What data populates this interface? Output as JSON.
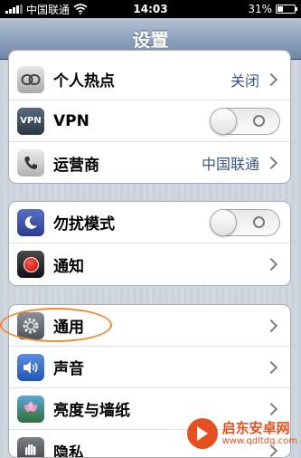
{
  "status_bar": {
    "carrier": "中国联通",
    "time": "14:03",
    "battery_text": "31%",
    "battery_level": 0.31
  },
  "nav": {
    "title": "设置"
  },
  "groups": [
    {
      "rows": [
        {
          "label": "个人热点",
          "value": "关闭",
          "icon": "hotspot-link-icon",
          "accessory": "chevron"
        },
        {
          "label": "VPN",
          "icon_text": "VPN",
          "icon": "vpn-icon",
          "accessory": "toggle",
          "toggle_on": false
        },
        {
          "label": "运营商",
          "value": "中国联通",
          "icon": "phone-icon",
          "accessory": "chevron"
        }
      ]
    },
    {
      "rows": [
        {
          "label": "勿扰模式",
          "icon": "moon-icon",
          "accessory": "toggle",
          "toggle_on": false
        },
        {
          "label": "通知",
          "icon": "notification-icon",
          "accessory": "chevron"
        }
      ]
    },
    {
      "rows": [
        {
          "label": "通用",
          "icon": "gear-icon",
          "accessory": "chevron",
          "highlighted": true
        },
        {
          "label": "声音",
          "icon": "speaker-icon",
          "accessory": "chevron"
        },
        {
          "label": "亮度与墙纸",
          "icon": "flower-icon",
          "accessory": "chevron"
        },
        {
          "label": "隐私",
          "icon": "hand-icon",
          "accessory": "chevron"
        }
      ]
    }
  ],
  "watermark": {
    "name": "启东安卓网",
    "url": "www.qdltdq.com"
  },
  "colors": {
    "annotation": "#ef8a2e",
    "value_text": "#385487",
    "nav_top": "#b4c3d6",
    "nav_bottom": "#6f87a7"
  }
}
